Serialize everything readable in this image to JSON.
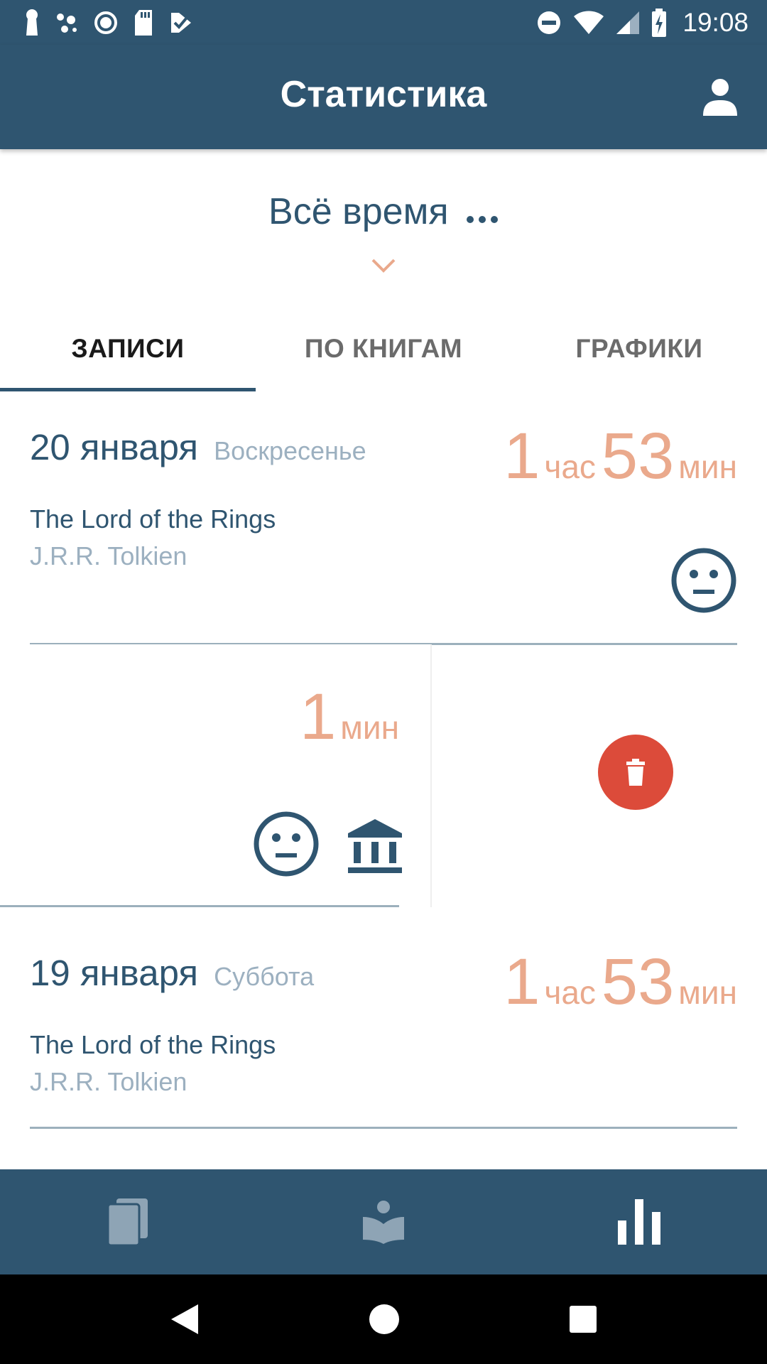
{
  "status_bar": {
    "time": "19:08"
  },
  "app_bar": {
    "title": "Статистика"
  },
  "period": {
    "label": "Всё время"
  },
  "tabs": [
    {
      "label": "ЗАПИСИ",
      "active": true
    },
    {
      "label": "ПО КНИГАМ",
      "active": false
    },
    {
      "label": "ГРАФИКИ",
      "active": false
    }
  ],
  "entries": [
    {
      "date": "20 января",
      "weekday": "Воскресенье",
      "hours": "1",
      "hours_unit": "час",
      "minutes": "53",
      "minutes_unit": "мин",
      "book": "The Lord of the Rings",
      "author": "J.R.R. Tolkien",
      "mood_icon": "neutral-face-icon"
    },
    {
      "minutes": "1",
      "minutes_unit": "мин",
      "mood_icon": "neutral-face-icon",
      "source_icon": "library-icon",
      "action": "delete"
    },
    {
      "date": "19 января",
      "weekday": "Суббота",
      "hours": "1",
      "hours_unit": "час",
      "minutes": "53",
      "minutes_unit": "мин",
      "book": "The Lord of the Rings",
      "author": "J.R.R. Tolkien"
    }
  ],
  "bottom_nav": [
    {
      "icon": "books-icon",
      "active": false
    },
    {
      "icon": "reading-icon",
      "active": false
    },
    {
      "icon": "bar-chart-icon",
      "active": true
    }
  ],
  "colors": {
    "primary": "#2f5570",
    "accent": "#eaa98c",
    "muted": "#9cb0c0",
    "delete": "#dc4b3a"
  }
}
